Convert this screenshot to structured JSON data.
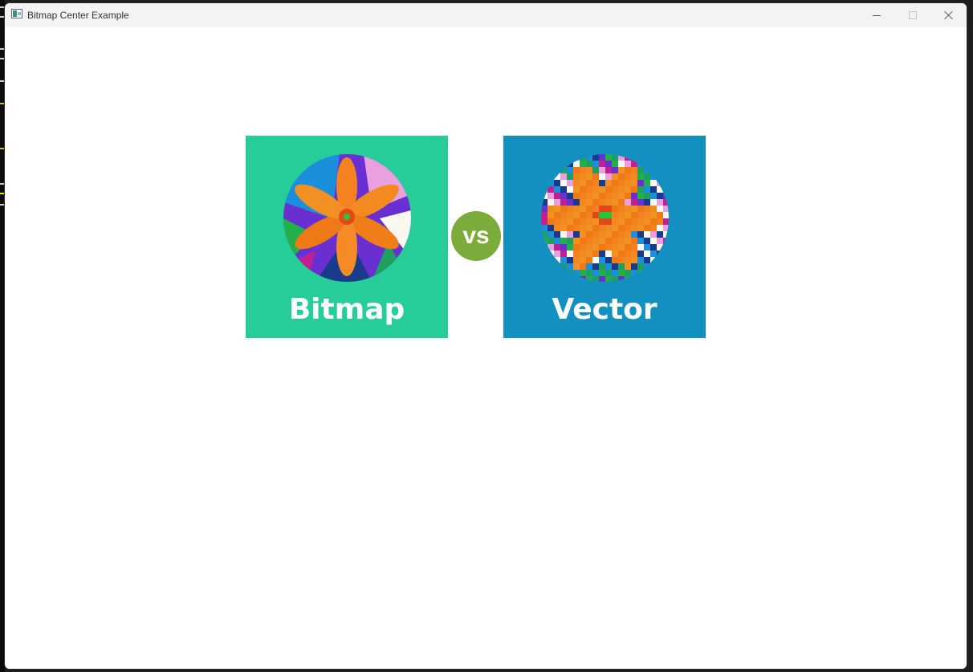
{
  "window": {
    "title": "Bitmap Center Example"
  },
  "cards": {
    "bitmap": {
      "label": "Bitmap",
      "color": "#26cd98"
    },
    "vector": {
      "label": "Vector",
      "color": "#1490c0"
    }
  },
  "vs": {
    "label": "vs",
    "color": "#7bab3a"
  },
  "icons": {
    "app": "app-icon",
    "minimize": "minimize-icon",
    "maximize": "maximize-icon",
    "close": "close-icon"
  }
}
